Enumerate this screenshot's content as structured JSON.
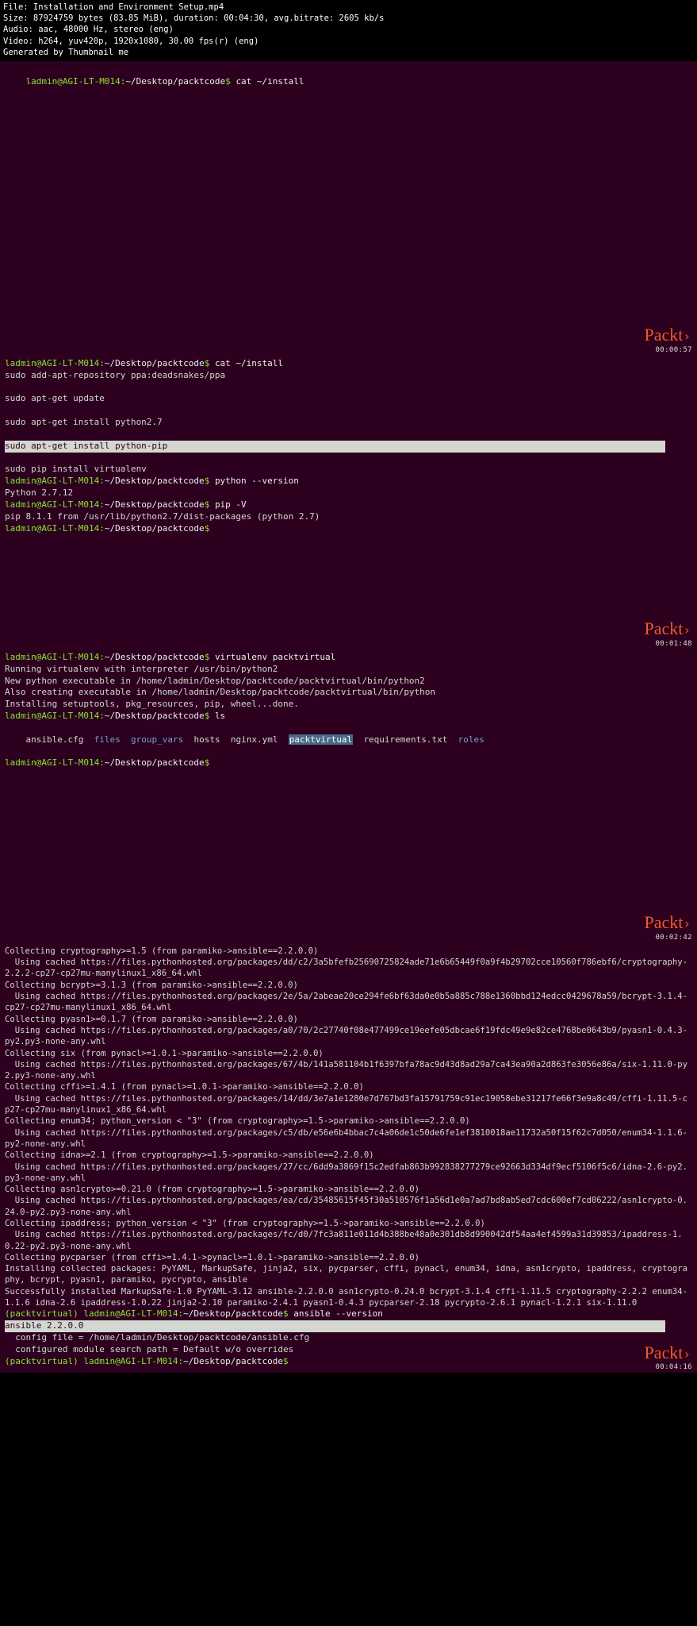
{
  "header": {
    "l1": "File: Installation and Environment Setup.mp4",
    "l2": "Size: 87924759 bytes (83.85 MiB), duration: 00:04:30, avg.bitrate: 2605 kb/s",
    "l3": "Audio: aac, 48000 Hz, stereo (eng)",
    "l4": "Video: h264, yuv420p, 1920x1080, 30.00 fps(r) (eng)",
    "l5": "Generated by Thumbnail me"
  },
  "brand": "Packt",
  "brand_arrow": "›",
  "colors": {
    "terminal_bg": "#2c001e",
    "prompt": "#8ae234",
    "dir": "#729fcf",
    "brand": "#f05a28"
  },
  "frame1": {
    "prompt_user": "ladmin@AGI-LT-M014:",
    "prompt_path": "~/Desktop/packtcode",
    "prompt_sym": "$ ",
    "cmd": "cat ~/install",
    "ts": "00:00:57"
  },
  "frame2": {
    "l1_prompt_user": "ladmin@AGI-LT-M014:",
    "l1_prompt_path": "~/Desktop/packtcode",
    "l1_prompt_sym": "$ ",
    "l1_cmd": "cat ~/install",
    "l2": "sudo add-apt-repository ppa:deadsnakes/ppa",
    "l4": "sudo apt-get update",
    "l6": "sudo apt-get install python2.7",
    "l8_hl": "sudo apt-get install python-pip",
    "l10": "sudo pip install virtualenv",
    "l11_prompt_user": "ladmin@AGI-LT-M014:",
    "l11_prompt_path": "~/Desktop/packtcode",
    "l11_prompt_sym": "$ ",
    "l11_cmd": "python --version",
    "l12": "Python 2.7.12",
    "l13_prompt_user": "ladmin@AGI-LT-M014:",
    "l13_prompt_path": "~/Desktop/packtcode",
    "l13_prompt_sym": "$ ",
    "l13_cmd": "pip -V",
    "l14": "pip 8.1.1 from /usr/lib/python2.7/dist-packages (python 2.7)",
    "l15_prompt_user": "ladmin@AGI-LT-M014:",
    "l15_prompt_path": "~/Desktop/packtcode",
    "l15_prompt_sym": "$",
    "ts": "00:01:48"
  },
  "frame3": {
    "l1_prompt_user": "ladmin@AGI-LT-M014:",
    "l1_prompt_path": "~/Desktop/packtcode",
    "l1_prompt_sym": "$ ",
    "l1_cmd": "virtualenv packtvirtual",
    "l2": "Running virtualenv with interpreter /usr/bin/python2",
    "l3": "New python executable in /home/ladmin/Desktop/packtcode/packtvirtual/bin/python2",
    "l4": "Also creating executable in /home/ladmin/Desktop/packtcode/packtvirtual/bin/python",
    "l5": "Installing setuptools, pkg_resources, pip, wheel...done.",
    "l6_prompt_user": "ladmin@AGI-LT-M014:",
    "l6_prompt_path": "~/Desktop/packtcode",
    "l6_prompt_sym": "$ ",
    "l6_cmd": "ls",
    "ls_ansible": "ansible.cfg",
    "ls_files": "files",
    "ls_gv": "group_vars",
    "ls_hosts": "hosts",
    "ls_nginx": "nginx.yml",
    "ls_pv": "packtvirtual",
    "ls_req": "requirements.txt",
    "ls_roles": "roles",
    "l8_prompt_user": "ladmin@AGI-LT-M014:",
    "l8_prompt_path": "~/Desktop/packtcode",
    "l8_prompt_sym": "$ ",
    "ts": "00:02:42"
  },
  "frame4": {
    "body": "Collecting cryptography>=1.5 (from paramiko->ansible==2.2.0.0)\n  Using cached https://files.pythonhosted.org/packages/dd/c2/3a5bfefb25690725824ade71e6b65449f0a9f4b29702cce10560f786ebf6/cryptography-2.2.2-cp27-cp27mu-manylinux1_x86_64.whl\nCollecting bcrypt>=3.1.3 (from paramiko->ansible==2.2.0.0)\n  Using cached https://files.pythonhosted.org/packages/2e/5a/2abeae20ce294fe6bf63da0e0b5a885c788e1360bbd124edcc0429678a59/bcrypt-3.1.4-cp27-cp27mu-manylinux1_x86_64.whl\nCollecting pyasn1>=0.1.7 (from paramiko->ansible==2.2.0.0)\n  Using cached https://files.pythonhosted.org/packages/a0/70/2c27740f08e477499ce19eefe05dbcae6f19fdc49e9e82ce4768be0643b9/pyasn1-0.4.3-py2.py3-none-any.whl\nCollecting six (from pynacl>=1.0.1->paramiko->ansible==2.2.0.0)\n  Using cached https://files.pythonhosted.org/packages/67/4b/141a581104b1f6397bfa78ac9d43d8ad29a7ca43ea90a2d863fe3056e86a/six-1.11.0-py2.py3-none-any.whl\nCollecting cffi>=1.4.1 (from pynacl>=1.0.1->paramiko->ansible==2.2.0.0)\n  Using cached https://files.pythonhosted.org/packages/14/dd/3e7a1e1280e7d767bd3fa15791759c91ec19058ebe31217fe66f3e9a8c49/cffi-1.11.5-cp27-cp27mu-manylinux1_x86_64.whl\nCollecting enum34; python_version < \"3\" (from cryptography>=1.5->paramiko->ansible==2.2.0.0)\n  Using cached https://files.pythonhosted.org/packages/c5/db/e56e6b4bbac7c4a06de1c50de6fe1ef3810018ae11732a50f15f62c7d050/enum34-1.1.6-py2-none-any.whl\nCollecting idna>=2.1 (from cryptography>=1.5->paramiko->ansible==2.2.0.0)\n  Using cached https://files.pythonhosted.org/packages/27/cc/6dd9a3869f15c2edfab863b992838277279ce92663d334df9ecf5106f5c6/idna-2.6-py2.py3-none-any.whl\nCollecting asn1crypto>=0.21.0 (from cryptography>=1.5->paramiko->ansible==2.2.0.0)\n  Using cached https://files.pythonhosted.org/packages/ea/cd/35485615f45f30a510576f1a56d1e0a7ad7bd8ab5ed7cdc600ef7cd06222/asn1crypto-0.24.0-py2.py3-none-any.whl\nCollecting ipaddress; python_version < \"3\" (from cryptography>=1.5->paramiko->ansible==2.2.0.0)\n  Using cached https://files.pythonhosted.org/packages/fc/d0/7fc3a811e011d4b388be48a0e301db8d990042df54aa4ef4599a31d39853/ipaddress-1.0.22-py2.py3-none-any.whl\nCollecting pycparser (from cffi>=1.4.1->pynacl>=1.0.1->paramiko->ansible==2.2.0.0)\nInstalling collected packages: PyYAML, MarkupSafe, jinja2, six, pycparser, cffi, pynacl, enum34, idna, asn1crypto, ipaddress, cryptography, bcrypt, pyasn1, paramiko, pycrypto, ansible\nSuccessfully installed MarkupSafe-1.0 PyYAML-3.12 ansible-2.2.0.0 asn1crypto-0.24.0 bcrypt-3.1.4 cffi-1.11.5 cryptography-2.2.2 enum34-1.1.6 idna-2.6 ipaddress-1.0.22 jinja2-2.10 paramiko-2.4.1 pyasn1-0.4.3 pycparser-2.18 pycrypto-2.6.1 pynacl-1.2.1 six-1.11.0",
    "pv_prompt": "(packtvirtual) ladmin@AGI-LT-M014:",
    "pv_path": "~/Desktop/packtcode",
    "pv_sym": "$ ",
    "pv_cmd": "ansible --version",
    "ver_hl": "ansible 2.2.0.0",
    "ver_l2": "  config file = /home/ladmin/Desktop/packtcode/ansible.cfg",
    "ver_l3": "  configured module search path = Default w/o overrides",
    "pv2_prompt": "(packtvirtual) ladmin@AGI-LT-M014:",
    "pv2_path": "~/Desktop/packtcode",
    "pv2_sym": "$",
    "ts": "00:04:16"
  }
}
